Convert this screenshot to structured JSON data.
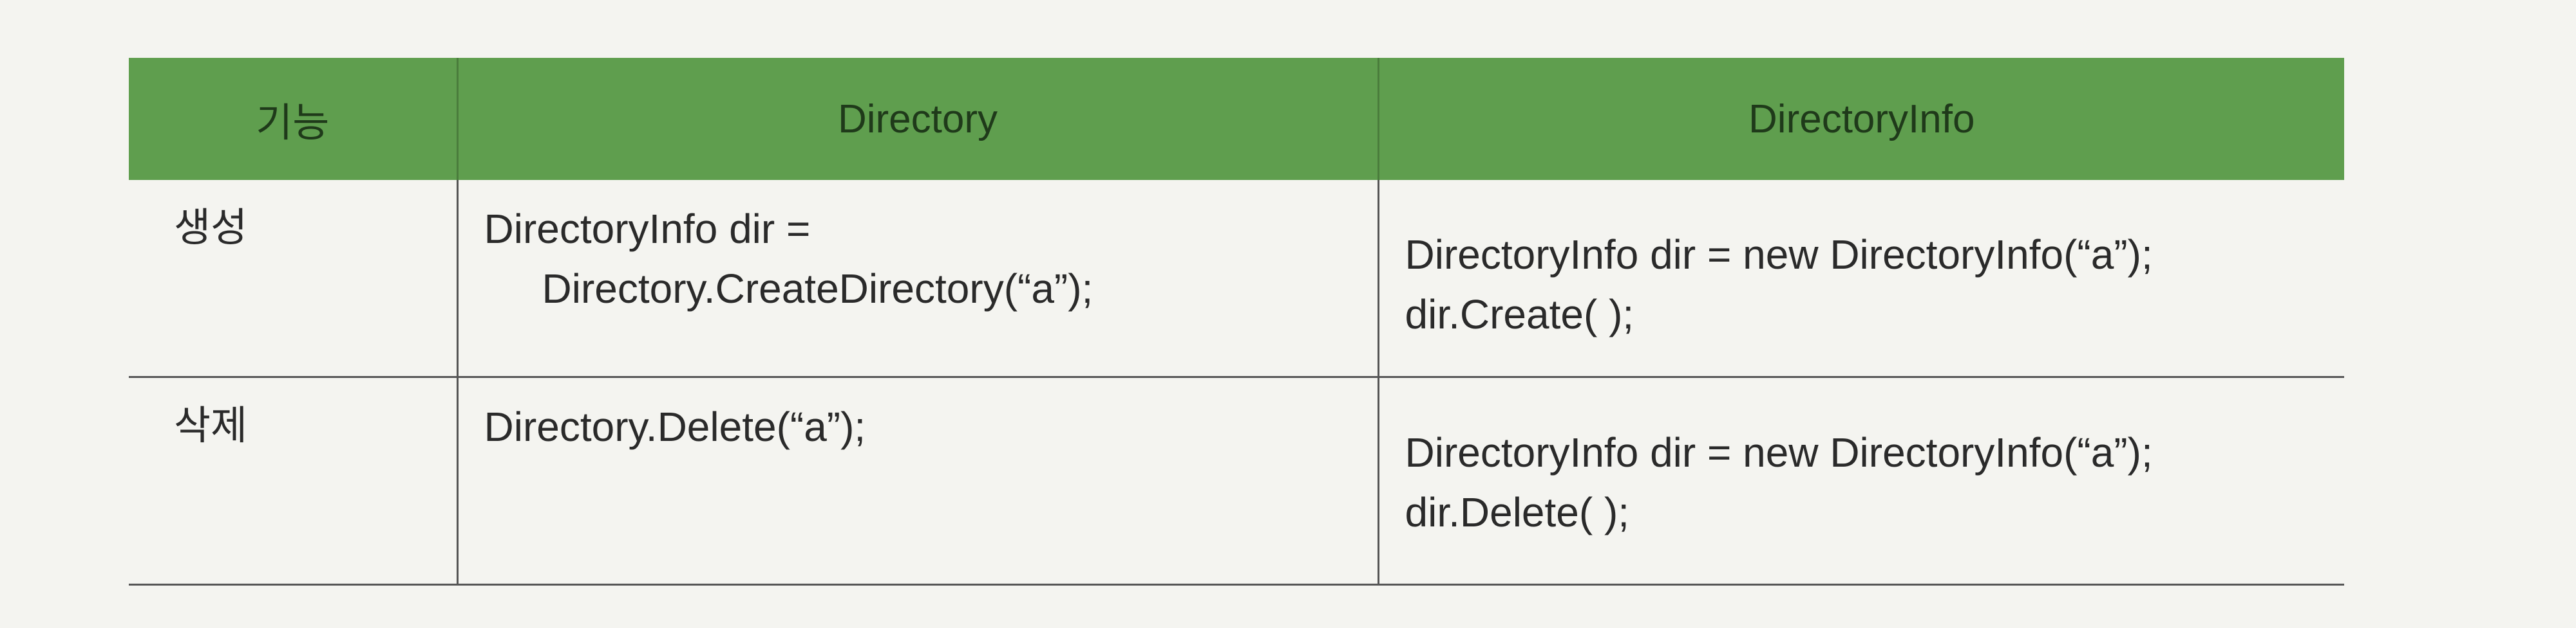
{
  "table": {
    "headers": [
      "기능",
      "Directory",
      "DirectoryInfo"
    ],
    "rows": [
      {
        "function": "생성",
        "directory": [
          "DirectoryInfo dir =",
          "Directory.CreateDirectory(“a”);"
        ],
        "directory_info": [
          "DirectoryInfo dir = new DirectoryInfo(“a”);",
          "dir.Create( );"
        ]
      },
      {
        "function": "삭제",
        "directory": [
          "Directory.Delete(“a”);"
        ],
        "directory_info": [
          "DirectoryInfo dir = new DirectoryInfo(“a”);",
          "dir.Delete( );"
        ]
      }
    ]
  },
  "colors": {
    "header_bg": "#5f9e4e",
    "header_text": "#1f3a1a",
    "rule": "#555555"
  }
}
